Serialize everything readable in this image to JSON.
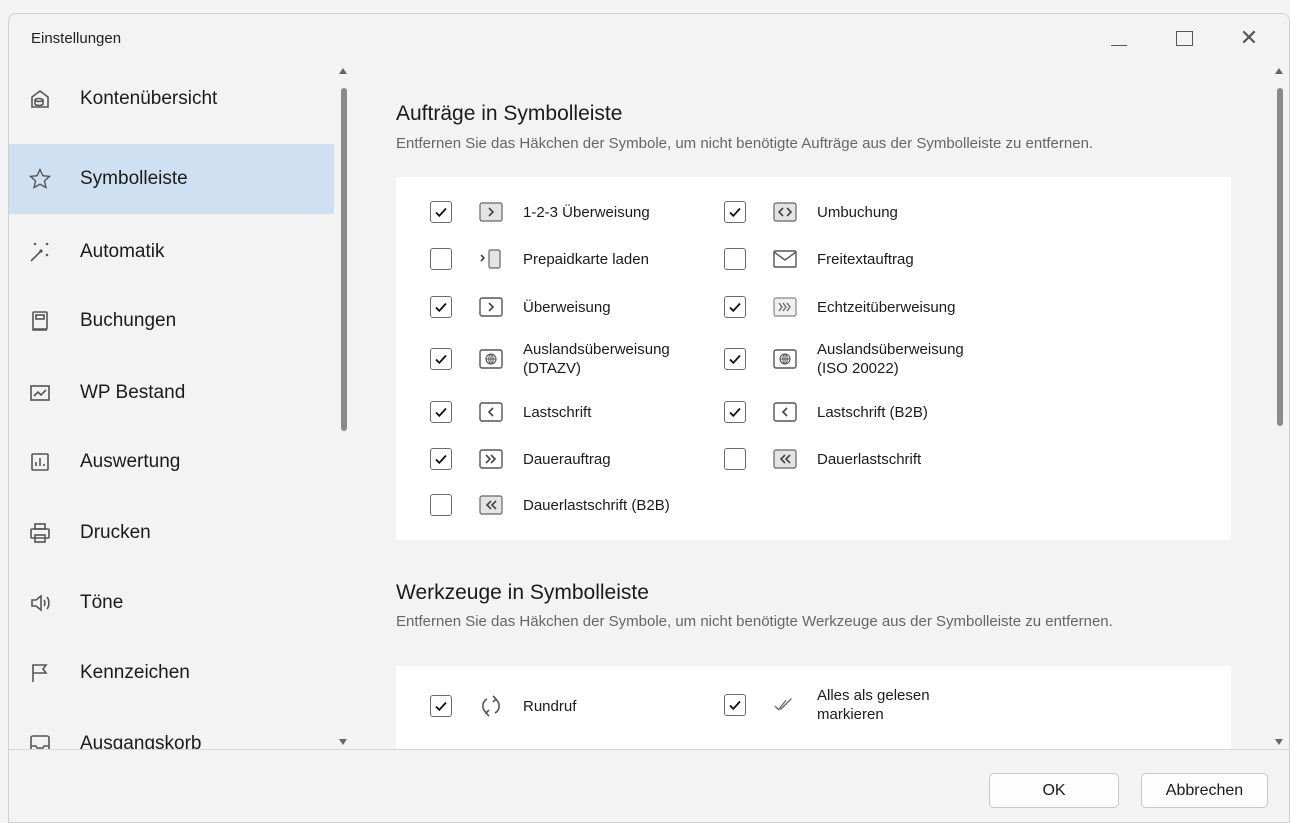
{
  "window": {
    "title": "Einstellungen"
  },
  "sidebar": {
    "items": [
      {
        "label": "Kontenübersicht",
        "icon": "account-overview-icon",
        "active": false
      },
      {
        "label": "Symbolleiste",
        "icon": "star-icon",
        "active": true
      },
      {
        "label": "Automatik",
        "icon": "magic-wand-icon",
        "active": false
      },
      {
        "label": "Buchungen",
        "icon": "book-icon",
        "active": false
      },
      {
        "label": "WP Bestand",
        "icon": "stock-chart-icon",
        "active": false
      },
      {
        "label": "Auswertung",
        "icon": "bar-chart-icon",
        "active": false
      },
      {
        "label": "Drucken",
        "icon": "printer-icon",
        "active": false
      },
      {
        "label": "Töne",
        "icon": "speaker-icon",
        "active": false
      },
      {
        "label": "Kennzeichen",
        "icon": "flag-icon",
        "active": false
      },
      {
        "label": "Ausgangskorb",
        "icon": "outbox-icon",
        "active": false
      }
    ]
  },
  "orders_section": {
    "title": "Aufträge in Symbolleiste",
    "description": "Entfernen Sie das Häkchen der Symbole, um nicht benötigte Aufträge aus der Symbolleiste zu entfernen.",
    "options": [
      {
        "label": "1-2-3 Überweisung",
        "checked": true,
        "icon": "transfer-123-icon"
      },
      {
        "label": "Umbuchung",
        "checked": true,
        "icon": "rebooking-icon"
      },
      {
        "label": "Prepaidkarte laden",
        "checked": false,
        "icon": "prepaid-card-icon"
      },
      {
        "label": "Freitextauftrag",
        "checked": false,
        "icon": "envelope-icon"
      },
      {
        "label": "Überweisung",
        "checked": true,
        "icon": "transfer-icon"
      },
      {
        "label": "Echtzeitüberweisung",
        "checked": true,
        "icon": "instant-transfer-icon"
      },
      {
        "label": "Auslandsüberweisung (DTAZV)",
        "checked": true,
        "icon": "globe-icon"
      },
      {
        "label": "Auslandsüberweisung (ISO 20022)",
        "checked": true,
        "icon": "globe-icon"
      },
      {
        "label": "Lastschrift",
        "checked": true,
        "icon": "direct-debit-icon"
      },
      {
        "label": "Lastschrift (B2B)",
        "checked": true,
        "icon": "direct-debit-icon"
      },
      {
        "label": "Dauerauftrag",
        "checked": true,
        "icon": "standing-order-icon"
      },
      {
        "label": "Dauerlastschrift",
        "checked": false,
        "icon": "standing-debit-icon"
      },
      {
        "label": "Dauerlastschrift (B2B)",
        "checked": false,
        "icon": "standing-debit-icon"
      }
    ]
  },
  "tools_section": {
    "title": "Werkzeuge in Symbolleiste",
    "description": "Entfernen Sie das Häkchen der Symbole, um nicht benötigte Werkzeuge aus der Symbolleiste zu entfernen.",
    "options": [
      {
        "label": "Rundruf",
        "checked": true,
        "icon": "refresh-icon"
      },
      {
        "label": "Alles als gelesen markieren",
        "checked": true,
        "icon": "mark-read-icon"
      }
    ]
  },
  "footer": {
    "ok_label": "OK",
    "cancel_label": "Abbrechen"
  }
}
